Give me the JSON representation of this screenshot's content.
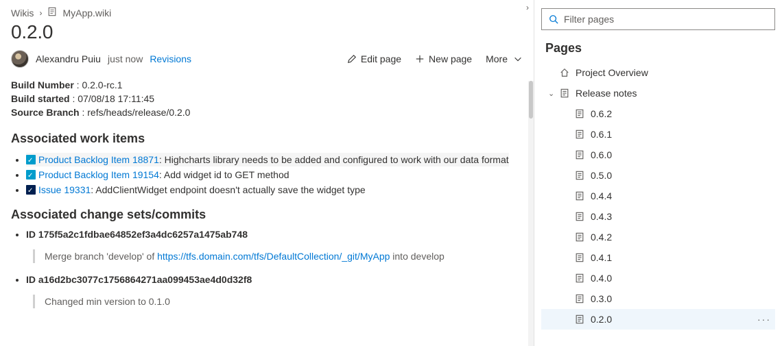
{
  "breadcrumb": {
    "root": "Wikis",
    "current": "MyApp.wiki"
  },
  "page": {
    "title": "0.2.0",
    "author": "Alexandru Puiu",
    "time_ago": "just now",
    "revisions_label": "Revisions"
  },
  "actions": {
    "edit": "Edit page",
    "new": "New page",
    "more": "More"
  },
  "build": {
    "number_label": "Build Number",
    "number_value": "0.2.0-rc.1",
    "started_label": "Build started",
    "started_value": "07/08/18 17:11:45",
    "branch_label": "Source Branch",
    "branch_value": "refs/heads/release/0.2.0"
  },
  "sections": {
    "work_items": "Associated work items",
    "commits": "Associated change sets/commits"
  },
  "work_items": [
    {
      "link": "Product Backlog Item 18871",
      "desc": "Highcharts library needs to be added and configured to work with our data format",
      "highlight": true,
      "dark": false
    },
    {
      "link": "Product Backlog Item 19154",
      "desc": "Add widget id to GET method",
      "highlight": false,
      "dark": false
    },
    {
      "link": "Issue 19331",
      "desc": "AddClientWidget endpoint doesn't actually save the widget type",
      "highlight": false,
      "dark": true
    }
  ],
  "commits": [
    {
      "id": "175f5a2c1fdbae64852ef3a4dc6257a1475ab748",
      "msg_prefix": "Merge branch 'develop' of ",
      "msg_link": "https://tfs.domain.com/tfs/DefaultCollection/_git/MyApp",
      "msg_suffix": " into develop"
    },
    {
      "id": "a16d2bc3077c1756864271aa099453ae4d0d32f8",
      "msg_prefix": "Changed min version to 0.1.0",
      "msg_link": "",
      "msg_suffix": ""
    }
  ],
  "side": {
    "filter_placeholder": "Filter pages",
    "pages_title": "Pages"
  },
  "tree": {
    "overview": "Project Overview",
    "release_notes": "Release notes",
    "versions": [
      "0.6.2",
      "0.6.1",
      "0.6.0",
      "0.5.0",
      "0.4.4",
      "0.4.3",
      "0.4.2",
      "0.4.1",
      "0.4.0",
      "0.3.0",
      "0.2.0"
    ],
    "selected": "0.2.0"
  },
  "id_prefix": "ID "
}
